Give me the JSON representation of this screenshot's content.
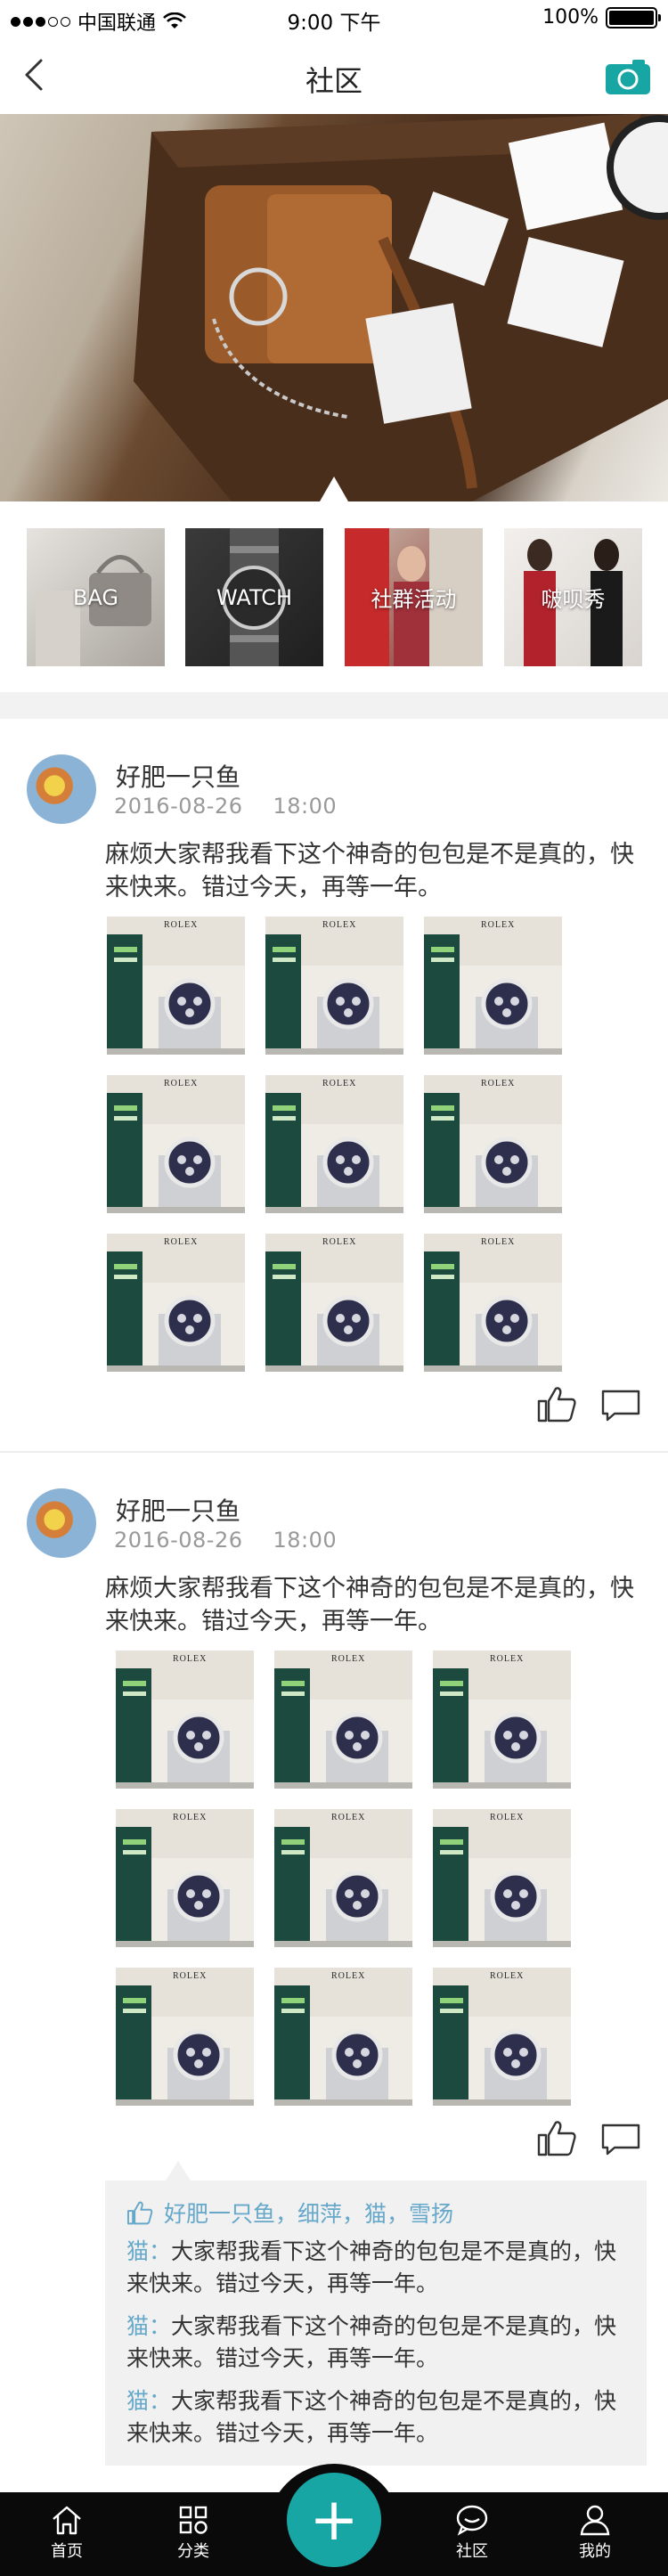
{
  "status_bar": {
    "carrier": "中国联通",
    "time": "9:00 下午",
    "battery": "100%",
    "signal_strength": "3/5"
  },
  "nav": {
    "title": "社区",
    "back_icon": "chevron-left-icon",
    "camera_icon": "camera-icon",
    "accent_color": "#18a6a4"
  },
  "categories": [
    {
      "label": "BAG"
    },
    {
      "label": "WATCH"
    },
    {
      "label": "社群活动"
    },
    {
      "label": "啵呗秀"
    }
  ],
  "posts": [
    {
      "username": "好肥一只鱼",
      "date": "2016-08-26",
      "time": "18:00",
      "text": "麻烦大家帮我看下这个神奇的包包是不是真的，快来快来。错过今天，再等一年。",
      "image_brand": "ROLEX",
      "image_count": 9
    },
    {
      "username": "好肥一只鱼",
      "date": "2016-08-26",
      "time": "18:00",
      "text": "麻烦大家帮我看下这个神奇的包包是不是真的，快来快来。错过今天，再等一年。",
      "image_brand": "ROLEX",
      "image_count": 9
    }
  ],
  "likes": {
    "names": "好肥一只鱼，细萍，猫，雪扬"
  },
  "comments": [
    {
      "author": "猫：",
      "text": "大家帮我看下这个神奇的包包是不是真的，快来快来。错过今天，再等一年。"
    },
    {
      "author": "猫：",
      "text": "大家帮我看下这个神奇的包包是不是真的，快来快来。错过今天，再等一年。"
    },
    {
      "author": "猫：",
      "text": "大家帮我看下这个神奇的包包是不是真的，快来快来。错过今天，再等一年。"
    }
  ],
  "tab_bar": {
    "items": [
      {
        "label": "首页",
        "icon": "home-icon"
      },
      {
        "label": "分类",
        "icon": "grid-icon"
      },
      {
        "label": "社区",
        "icon": "chat-icon"
      },
      {
        "label": "我的",
        "icon": "person-icon"
      }
    ],
    "fab_label": "+"
  },
  "colors": {
    "accent": "#18a6a4",
    "link": "#66a8c9",
    "tab_bar": "#0a0a0a"
  }
}
